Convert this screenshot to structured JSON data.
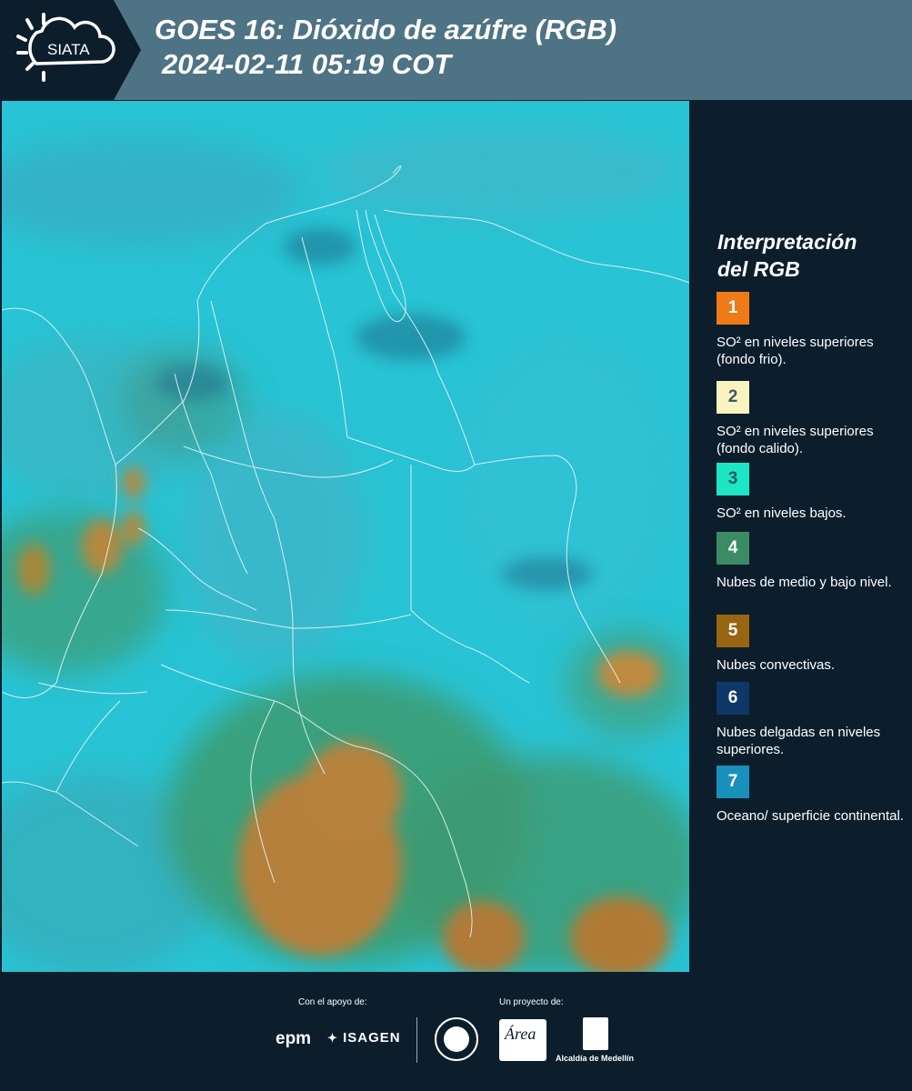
{
  "header": {
    "logo_text": "SIATA",
    "title_line1": "GOES 16: Dióxido de azúfre (RGB)",
    "title_line2": "2024-02-11 05:19 COT"
  },
  "legend": {
    "title_line1": "Interpretación",
    "title_line2": "del RGB",
    "items": [
      {
        "number": "1",
        "label": "SO² en niveles superiores (fondo frio).",
        "color": "#f07a17",
        "text_color": "#ffffff"
      },
      {
        "number": "2",
        "label": "SO² en niveles superiores (fondo calido).",
        "color": "#fbf3bf",
        "text_color": "#3c5a6a"
      },
      {
        "number": "3",
        "label": "SO² en niveles bajos.",
        "color": "#1de6c5",
        "text_color": "#1f5c5a"
      },
      {
        "number": "4",
        "label": "Nubes de medio y bajo nivel.",
        "color": "#3b8b64",
        "text_color": "#ffffff"
      },
      {
        "number": "5",
        "label": "Nubes convectivas.",
        "color": "#9a6512",
        "text_color": "#ffffff"
      },
      {
        "number": "6",
        "label": "Nubes delgadas en niveles superiores.",
        "color": "#0e3867",
        "text_color": "#ffffff"
      },
      {
        "number": "7",
        "label": "Oceano/ superficie continental.",
        "color": "#1890bb",
        "text_color": "#ffffff"
      }
    ]
  },
  "footer": {
    "support_label": "Con el apoyo de:",
    "project_label": "Un proyecto de:",
    "epm": "epm",
    "isagen": "ISAGEN",
    "area_logo_text": "Área",
    "medellin": "Alcaldía de Medellín"
  }
}
